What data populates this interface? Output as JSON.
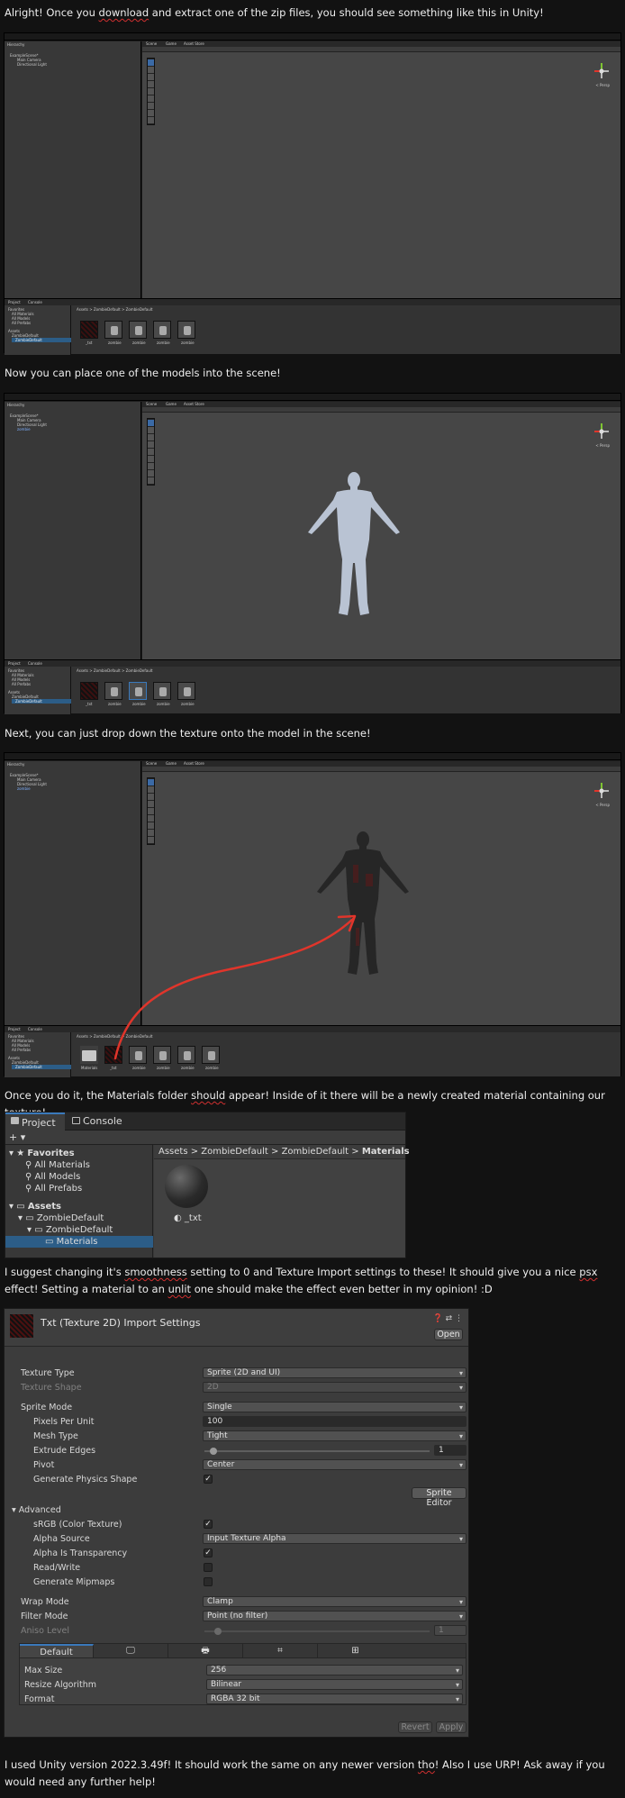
{
  "paragraphs": {
    "p1": [
      "Alright! Once you ",
      "download",
      " and extract one of the zip files, you should see something like this in Unity!"
    ],
    "p2": "Now you can place one of the models into the scene!",
    "p3": "Next, you can just drop down the texture onto the model in the scene!",
    "p4": [
      "Once you do it, the Materials folder ",
      "should",
      " appear! Inside of it there will be a newly created material containing our texture!"
    ],
    "p5": [
      "I suggest changing it's ",
      "smoothness",
      " setting to 0 and Texture Import settings to these! It should give you a nice ",
      "psx",
      " effect! Setting a material to an ",
      "unlit",
      " one should make the effect even better in my opinion! :D"
    ],
    "p6": [
      "I used Unity version 2022.3.49f! It should work the same on any newer version ",
      "tho",
      "! Also I use URP! Ask away if you would need any further help!"
    ]
  },
  "editor": {
    "hierarchy_label": "Hierarchy",
    "scene_tab": "Scene",
    "game_tab": "Game",
    "asset_tab": "Asset Store",
    "scene_root": "ExampleScene*",
    "main_camera": "Main Camera",
    "dir_light": "Directional Light",
    "model_item": "zombie",
    "persp": "< Persp",
    "project_tab": "Project",
    "console_tab": "Console",
    "favorites": "Favorites",
    "fav_items": [
      "All Materials",
      "All Models",
      "All Prefabs"
    ],
    "assets": "Assets",
    "asset_folder": "ZombieDefault",
    "bread": "Assets > ZombieDefault > ZombieDefault",
    "thumb_labels": [
      "_txt",
      "zombie",
      "zombie",
      "zombie",
      "zombie"
    ],
    "thumb_labels3": [
      "Materials",
      "_txt",
      "zombie",
      "zombie",
      "zombie",
      "zombie"
    ]
  },
  "project_window": {
    "tab_project": "Project",
    "tab_console": "Console",
    "add_btn": "+ ▾",
    "favorites": "Favorites",
    "fav_items": [
      "All Materials",
      "All Models",
      "All Prefabs"
    ],
    "assets": "Assets",
    "folder1": "ZombieDefault",
    "folder2": "ZombieDefault",
    "folder3": "Materials",
    "breadcrumb": [
      "Assets",
      "ZombieDefault",
      "ZombieDefault",
      "Materials"
    ],
    "material_label": "_txt"
  },
  "inspector": {
    "title": "Txt (Texture 2D) Import Settings",
    "open_btn": "Open",
    "rows": {
      "texture_type": {
        "label": "Texture Type",
        "value": "Sprite (2D and UI)"
      },
      "texture_shape": {
        "label": "Texture Shape",
        "value": "2D"
      },
      "sprite_mode": {
        "label": "Sprite Mode",
        "value": "Single"
      },
      "ppu": {
        "label": "Pixels Per Unit",
        "value": "100"
      },
      "mesh_type": {
        "label": "Mesh Type",
        "value": "Tight"
      },
      "extrude": {
        "label": "Extrude Edges",
        "value": "1"
      },
      "pivot": {
        "label": "Pivot",
        "value": "Center"
      },
      "gen_physics": {
        "label": "Generate Physics Shape"
      },
      "advanced": {
        "label": "Advanced"
      },
      "srgb": {
        "label": "sRGB (Color Texture)"
      },
      "alpha_source": {
        "label": "Alpha Source",
        "value": "Input Texture Alpha"
      },
      "alpha_transp": {
        "label": "Alpha Is Transparency"
      },
      "read_write": {
        "label": "Read/Write"
      },
      "mipmaps": {
        "label": "Generate Mipmaps"
      },
      "wrap": {
        "label": "Wrap Mode",
        "value": "Clamp"
      },
      "filter": {
        "label": "Filter Mode",
        "value": "Point (no filter)"
      },
      "aniso": {
        "label": "Aniso Level",
        "value": "1"
      }
    },
    "sprite_editor_btn": "Sprite Editor",
    "platform_tab": "Default",
    "max_size": {
      "label": "Max Size",
      "value": "256"
    },
    "resize": {
      "label": "Resize Algorithm",
      "value": "Bilinear"
    },
    "format": {
      "label": "Format",
      "value": "RGBA 32 bit"
    },
    "revert_btn": "Revert",
    "apply_btn": "Apply"
  },
  "colors": {
    "accent": "#3a79bb",
    "arrow": "#e0352b",
    "background": "#121212"
  }
}
